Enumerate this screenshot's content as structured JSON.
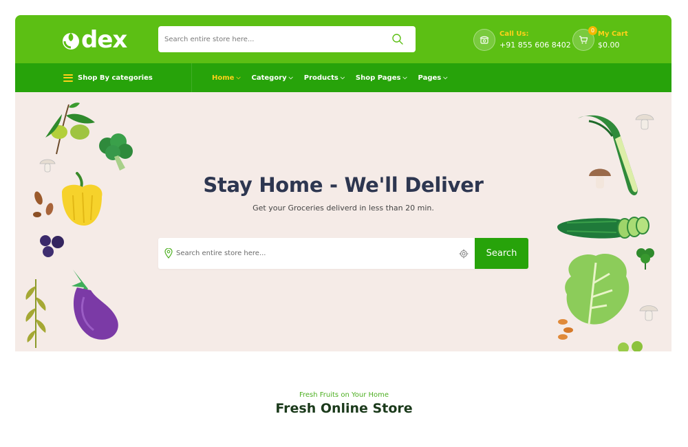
{
  "brand": {
    "name": "dex"
  },
  "header": {
    "search_placeholder": "Search entire store here...",
    "call": {
      "label": "Call Us:",
      "value": "+91 855 606 8402"
    },
    "cart": {
      "label": "My Cart",
      "value": "$0.00",
      "count": "0"
    }
  },
  "nav": {
    "categories_label": "Shop By categories",
    "items": [
      {
        "label": "Home",
        "active": true
      },
      {
        "label": "Category",
        "active": false
      },
      {
        "label": "Products",
        "active": false
      },
      {
        "label": "Shop Pages",
        "active": false
      },
      {
        "label": "Pages",
        "active": false
      }
    ]
  },
  "hero": {
    "title": "Stay Home - We'll Deliver",
    "subtitle": "Get your Groceries deliverd in less than 20 min.",
    "search_placeholder": "Search entire store here...",
    "search_button": "Search"
  },
  "section": {
    "kicker": "Fresh Fruits on Your Home",
    "title": "Fresh Online Store"
  },
  "colors": {
    "header_green": "#5cbf14",
    "nav_green": "#27a30a",
    "accent_yellow": "#ffd11a",
    "hero_bg": "#f5ebe7"
  },
  "icons": [
    "logo-mark-icon",
    "search-icon",
    "phone-icon",
    "cart-icon",
    "menu-icon",
    "chevron-down-icon",
    "location-pin-icon",
    "target-icon"
  ]
}
